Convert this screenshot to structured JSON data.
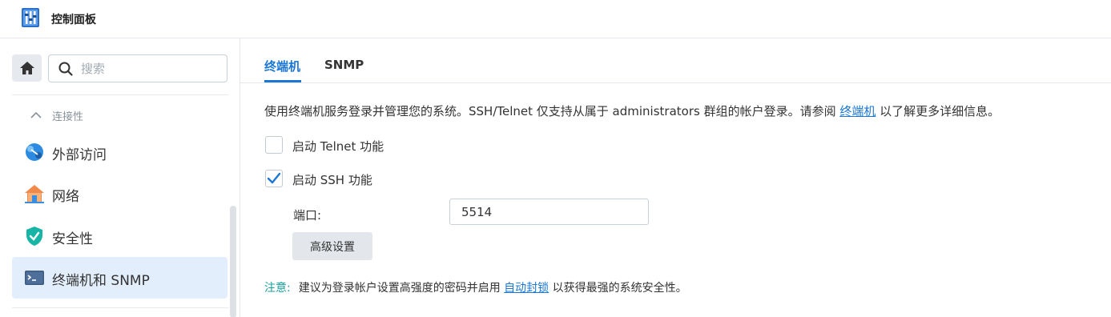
{
  "app": {
    "title": "控制面板"
  },
  "sidebar": {
    "search_placeholder": "搜索",
    "group": "连接性",
    "items": [
      {
        "label": "外部访问",
        "icon": "external-access-icon"
      },
      {
        "label": "网络",
        "icon": "network-home-icon"
      },
      {
        "label": "安全性",
        "icon": "security-shield-icon"
      },
      {
        "label": "终端机和 SNMP",
        "icon": "terminal-icon",
        "active": true
      }
    ]
  },
  "tabs": [
    {
      "label": "终端机",
      "active": true
    },
    {
      "label": "SNMP",
      "active": false
    }
  ],
  "content": {
    "desc_prefix": "使用终端机服务登录并管理您的系统。SSH/Telnet 仅支持从属于 administrators 群组的帐户登录。请参阅 ",
    "desc_link": "终端机",
    "desc_suffix": " 以了解更多详细信息。",
    "telnet": {
      "label": "启动 Telnet 功能",
      "checked": false
    },
    "ssh": {
      "label": "启动 SSH 功能",
      "checked": true
    },
    "port_label": "端口:",
    "port_value": "5514",
    "advanced_button": "高级设置",
    "note_title": "注意:",
    "note_prefix": "建议为登录帐户设置高强度的密码并启用 ",
    "note_link": "自动封锁",
    "note_suffix": " 以获得最强的系统安全性。"
  },
  "colors": {
    "accent": "#1b77d6",
    "note": "#1aa09b",
    "active_bg": "#e2eefb"
  }
}
